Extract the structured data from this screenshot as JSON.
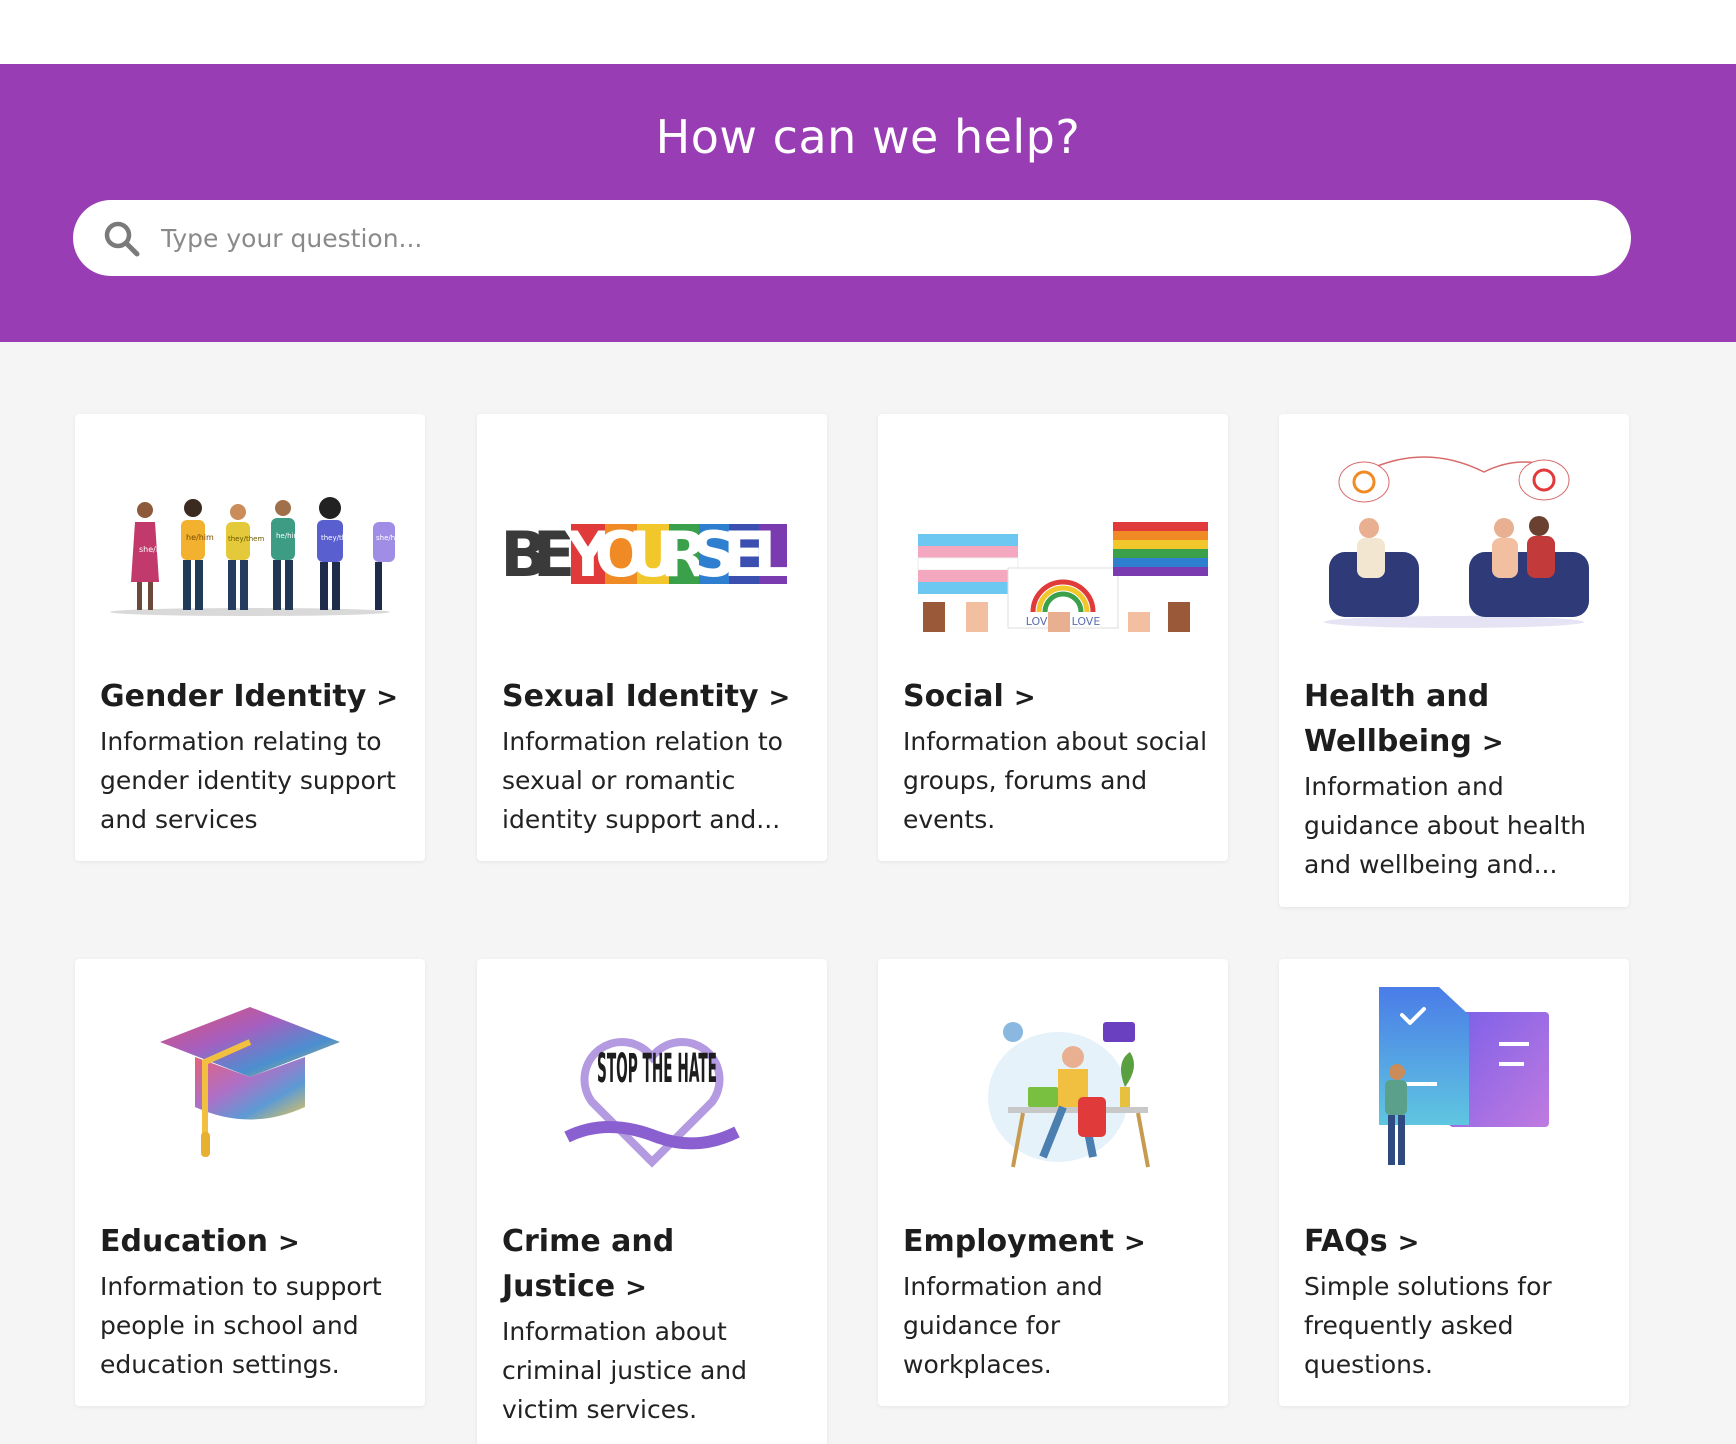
{
  "hero": {
    "title": "How can we help?",
    "search_placeholder": "Type your question..."
  },
  "colors": {
    "brand_purple": "#983db3",
    "page_bg": "#f5f5f5",
    "card_bg": "#ffffff"
  },
  "cards": [
    {
      "title": "Gender Identity",
      "description": "Information relating to gender identity support and services",
      "icon": "people-pronouns-illustration",
      "pronoun_labels": [
        "she/her",
        "he/him",
        "they/them",
        "he/him",
        "they/them",
        "she/her"
      ]
    },
    {
      "title": "Sexual Identity",
      "description": "Information relation to sexual or romantic identity support and...",
      "icon": "be-yourself-rainbow-illustration",
      "art_text": "BEYOURSELF"
    },
    {
      "title": "Social",
      "description": "Information about social groups, forums and events.",
      "icon": "pride-flags-hands-illustration",
      "art_text": "LOVE IS LOVE"
    },
    {
      "title": "Health and Wellbeing",
      "description": "Information and guidance about health and wellbeing and...",
      "icon": "counselling-session-illustration"
    },
    {
      "title": "Education",
      "description": "Information to support people in school and education settings.",
      "icon": "graduation-cap-illustration"
    },
    {
      "title": "Crime and Justice",
      "description": "Information about criminal justice and victim services.",
      "icon": "stop-the-hate-illustration",
      "art_text": "STOP THE HATE"
    },
    {
      "title": "Employment",
      "description": "Information and guidance for workplaces.",
      "icon": "remote-worker-illustration"
    },
    {
      "title": "FAQs",
      "description": "Simple solutions for frequently asked questions.",
      "icon": "documents-checklist-illustration"
    }
  ],
  "chevron": ">"
}
